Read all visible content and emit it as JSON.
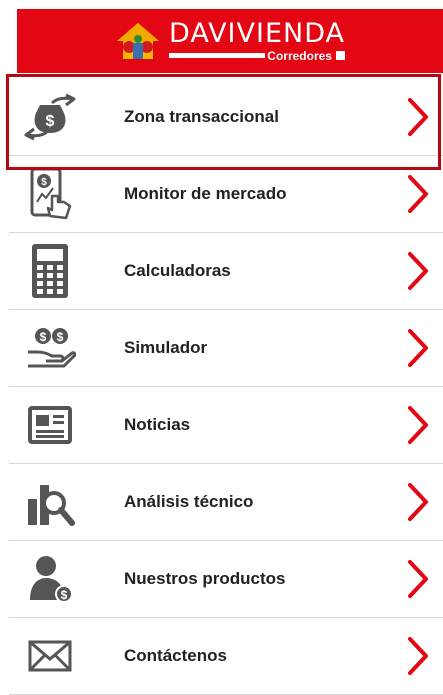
{
  "header": {
    "brand_name": "DAVIVIENDA",
    "brand_sub": "Corredores"
  },
  "menu": {
    "items": [
      {
        "label": "Zona transaccional",
        "icon": "money-exchange-icon"
      },
      {
        "label": "Monitor de mercado",
        "icon": "phone-touch-icon"
      },
      {
        "label": "Calculadoras",
        "icon": "calculator-icon"
      },
      {
        "label": "Simulador",
        "icon": "hand-coins-icon"
      },
      {
        "label": "Noticias",
        "icon": "newspaper-icon"
      },
      {
        "label": "Análisis técnico",
        "icon": "chart-magnifier-icon"
      },
      {
        "label": "Nuestros productos",
        "icon": "person-dollar-icon"
      },
      {
        "label": "Contáctenos",
        "icon": "envelope-icon"
      }
    ]
  },
  "colors": {
    "brand_red": "#e30613",
    "chevron_red": "#e30613",
    "icon_gray": "#555555",
    "highlight": "#b4070f"
  }
}
